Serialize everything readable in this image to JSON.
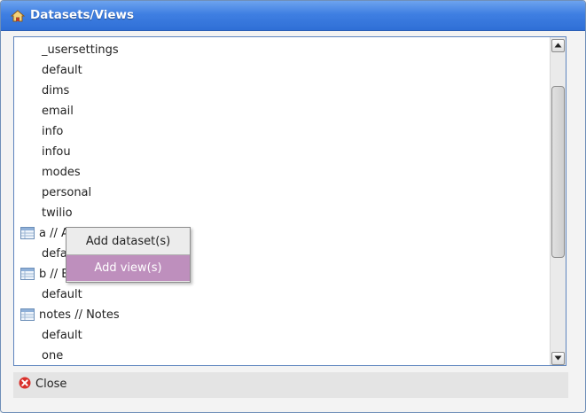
{
  "window": {
    "title": "Datasets/Views"
  },
  "list": {
    "items": [
      {
        "label": "_usersettings"
      },
      {
        "label": "default"
      },
      {
        "label": "dims"
      },
      {
        "label": "email"
      },
      {
        "label": "info"
      },
      {
        "label": "infou"
      },
      {
        "label": "modes"
      },
      {
        "label": "personal"
      },
      {
        "label": "twilio"
      },
      {
        "label": "a // A"
      },
      {
        "label": "default"
      },
      {
        "label": "b // B"
      },
      {
        "label": "default"
      },
      {
        "label": "notes // Notes"
      },
      {
        "label": "default"
      },
      {
        "label": "one"
      }
    ]
  },
  "context_menu": {
    "items": [
      {
        "label": "Add dataset(s)"
      },
      {
        "label": "Add view(s)"
      }
    ],
    "highlight_color": "#be8fbd"
  },
  "footer": {
    "close_label": "Close"
  },
  "colors": {
    "titlebar": "#3f7fe2",
    "list_border": "#5d84be",
    "close_icon": "#d9302b"
  },
  "icons": {
    "title": "home-icon",
    "group": "table-icon",
    "close": "close-icon"
  }
}
